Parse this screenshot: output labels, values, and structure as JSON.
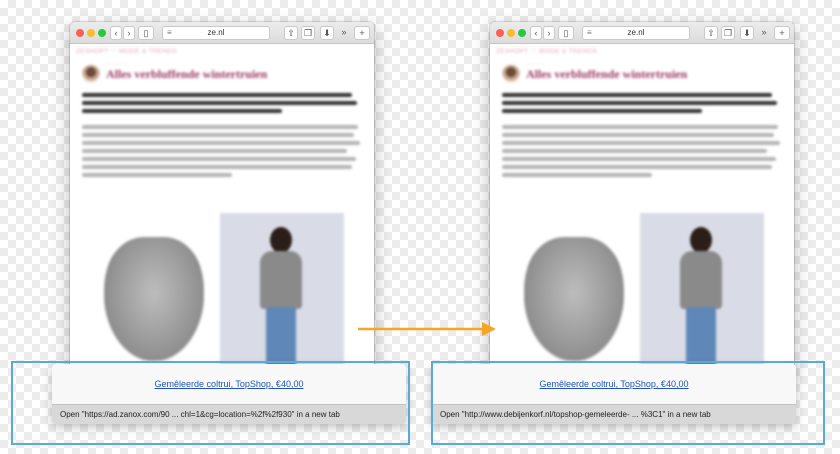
{
  "colors": {
    "accent_highlight": "#5aa9d6",
    "arrow": "#f5a623",
    "link": "#1f55b8",
    "brand": "#9c3a66"
  },
  "browser": {
    "address_text": "ze.nl",
    "icons": [
      "back-chevron-icon",
      "forward-chevron-icon",
      "sidebar-icon",
      "reader-menu-icon",
      "share-icon",
      "tabs-icon",
      "download-icon",
      "overflow-icon",
      "new-tab-plus-icon"
    ]
  },
  "article": {
    "brand": "ZESHOPT ♡ MODE & TRENDS",
    "title": "Alles verbluffende wintertruien"
  },
  "popups": [
    {
      "link_text": "Gemêleerde coltrui, TopShop, €40,00",
      "status_text": "Open \"https://ad.zanox.com/90 ... chl=1&cg=location=%2f%2f930\" in a new tab"
    },
    {
      "link_text": "Gemêleerde coltrui, TopShop, €40,00",
      "status_text": "Open \"http://www.debijenkorf.nl/topshop-gemeleerde- ... %3C1\" in a new tab"
    }
  ]
}
